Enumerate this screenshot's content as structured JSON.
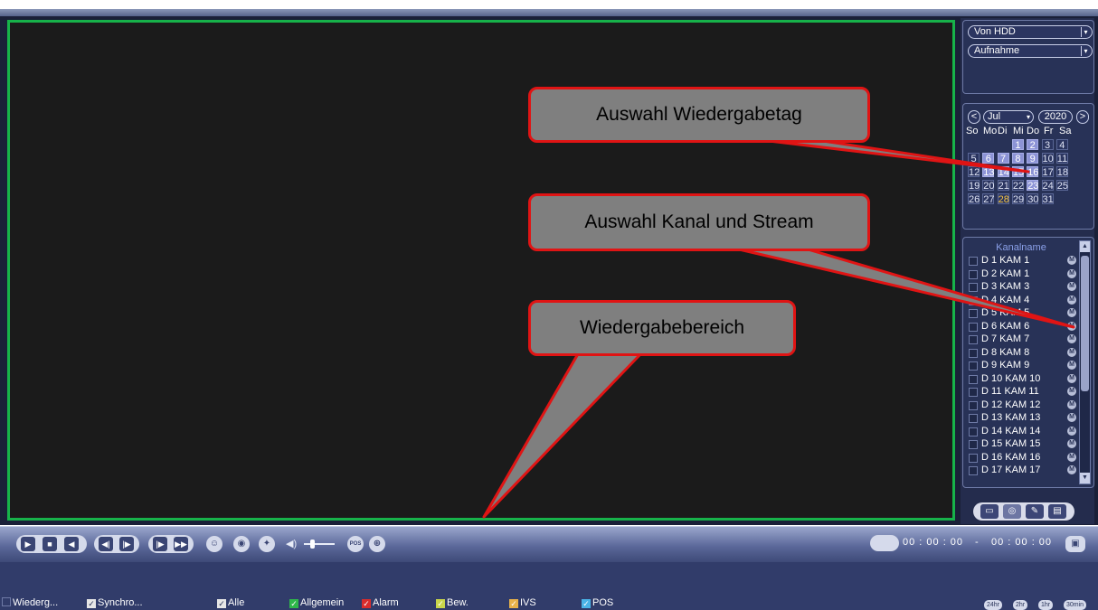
{
  "source_selects": {
    "source": "Von HDD",
    "type": "Aufnahme"
  },
  "calendar": {
    "month": "Jul",
    "year": "2020",
    "prev_symbol": "<",
    "next_symbol": ">",
    "weekdays": [
      "So",
      "Mo",
      "Di",
      "Mi",
      "Do",
      "Fr",
      "Sa"
    ],
    "days": [
      "1",
      "2",
      "3",
      "4",
      "5",
      "6",
      "7",
      "8",
      "9",
      "10",
      "11",
      "12",
      "13",
      "14",
      "15",
      "16",
      "17",
      "18",
      "19",
      "20",
      "21",
      "22",
      "23",
      "24",
      "25",
      "26",
      "27",
      "28",
      "29",
      "30",
      "31"
    ],
    "days_with_recordings": [
      "1",
      "2",
      "6",
      "7",
      "8",
      "9",
      "13",
      "14",
      "15",
      "16",
      "23"
    ],
    "highlighted_day": "28"
  },
  "channel_list": {
    "header": "Kanalname",
    "stream_marker": "M",
    "channels": [
      "D 1 KAM 1",
      "D 2 KAM 1",
      "D 3 KAM 3",
      "D 4 KAM 4",
      "D 5 KAM 5",
      "D 6 KAM 6",
      "D 7 KAM 7",
      "D 8 KAM 8",
      "D 9 KAM 9",
      "D 10 KAM 10",
      "D 11 KAM 11",
      "D 12 KAM 12",
      "D 13 KAM 13",
      "D 14 KAM 14",
      "D 15 KAM 15",
      "D 16 KAM 16",
      "D 17 KAM 17"
    ]
  },
  "controls": {
    "time_start": "00 : 00 : 00",
    "time_sep": "-",
    "time_end": "00 : 00 : 00",
    "pos_label": "POS"
  },
  "filters": {
    "playback": "Wiederg...",
    "sync": "Synchro...",
    "all": "Alle",
    "general": "Allgemein",
    "alarm": "Alarm",
    "motion": "Bew.",
    "ivs": "IVS",
    "pos": "POS"
  },
  "zoom_options": [
    "24hr",
    "2hr",
    "1hr",
    "30min"
  ],
  "callouts": {
    "day": "Auswahl Wiedergabetag",
    "channel": "Auswahl Kanal und Stream",
    "playback": "Wiedergabebereich"
  },
  "colors": {
    "video_border": "#17b24a",
    "callout_border": "#e01414",
    "callout_fill": "#7f7f7f",
    "recording_day": "#8c93d6"
  }
}
